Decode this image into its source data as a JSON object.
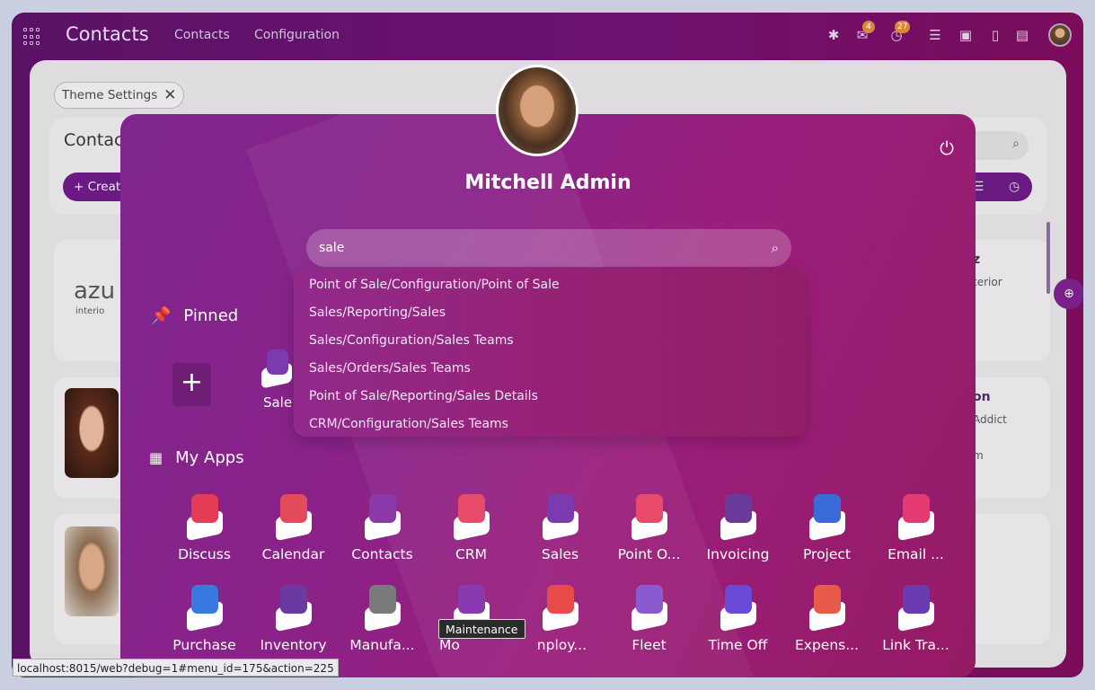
{
  "topbar": {
    "brand": "Contacts",
    "nav": [
      "Contacts",
      "Configuration"
    ],
    "badges": {
      "messages": "4",
      "activities": "27"
    }
  },
  "background": {
    "chip_label": "Theme Settings",
    "control_panel_title": "Contac",
    "create_label": "Creat",
    "card1_logo": "azu",
    "card1_sub": "interio",
    "card_right1_title": "z",
    "card_right1_sub": "terior",
    "card_right2_title": "on",
    "card_right2_sub": "Addict",
    "card_right2_sub2": "m"
  },
  "overlay": {
    "user_name": "Mitchell Admin",
    "search": {
      "value": "sale"
    },
    "suggestions": [
      "Point of Sale/Configuration/Point of Sale",
      "Sales/Reporting/Sales",
      "Sales/Configuration/Sales Teams",
      "Sales/Orders/Sales Teams",
      "Point of Sale/Reporting/Sales Details",
      "CRM/Configuration/Sales Teams"
    ],
    "pinned_title": "Pinned",
    "pinned_app": "Sale",
    "myapps_title": "My Apps",
    "apps_row1": [
      "Discuss",
      "Calendar",
      "Contacts",
      "CRM",
      "Sales",
      "Point O...",
      "Invoicing",
      "Project",
      "Email ..."
    ],
    "apps_row2": [
      "Purchase",
      "Inventory",
      "Manufa...",
      "Mo",
      "nploy...",
      "Fleet",
      "Time Off",
      "Expens...",
      "Link Tra..."
    ],
    "tooltip": "Maintenance"
  },
  "icon_colors": {
    "row1": [
      "#e43b57",
      "#e34a5c",
      "#8a3aa8",
      "#e84a6a",
      "#7a3ab0",
      "#e84a6a",
      "#6a3a9a",
      "#3a6ad8",
      "#e43a72"
    ],
    "row2": [
      "#3a7ae0",
      "#6a3aa0",
      "#7a7a7a",
      "#8a3ab0",
      "#e84a4a",
      "#8a5ad0",
      "#6a4ad8",
      "#e85a4a",
      "#6a3ab0"
    ]
  },
  "status_url": "localhost:8015/web?debug=1#menu_id=175&action=225"
}
